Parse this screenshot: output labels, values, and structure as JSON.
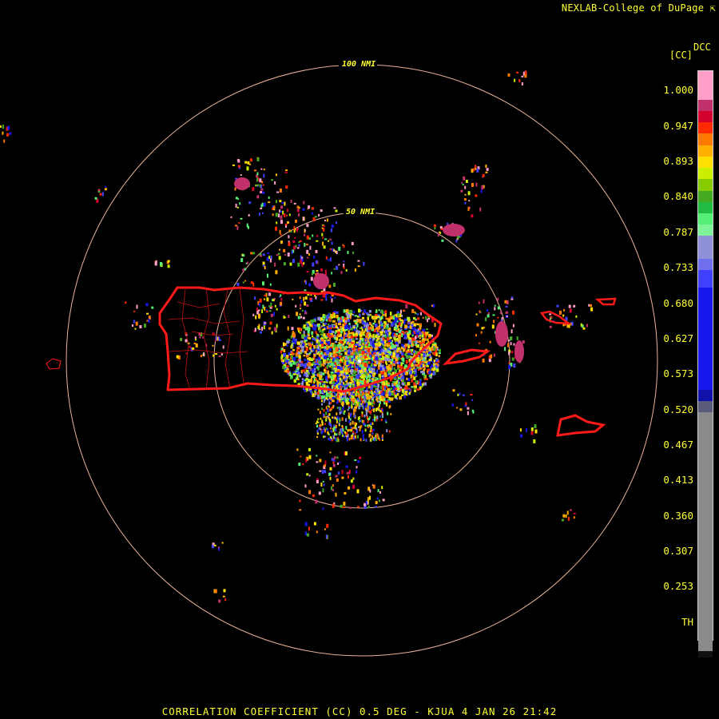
{
  "header": {
    "credit": "NEXLAB-College of DuPage",
    "credit_icon": "corner-arrow-icon"
  },
  "footer": {
    "title": "CORRELATION COEFFICIENT (CC) 0.5 DEG - KJUA 4 JAN 26 21:42"
  },
  "rings": {
    "outer_label": "100 NMI",
    "inner_label": "50 NMI"
  },
  "legend": {
    "product": "DCC",
    "unit": "[CC]",
    "ticks": [
      "1.000",
      "0.947",
      "0.893",
      "0.840",
      "0.787",
      "0.733",
      "0.680",
      "0.627",
      "0.573",
      "0.520",
      "0.467",
      "0.413",
      "0.360",
      "0.307",
      "0.253",
      "TH"
    ],
    "scale": [
      {
        "color": "#ff9fc8",
        "frac": 0.05
      },
      {
        "color": "#c0306a",
        "frac": 0.02
      },
      {
        "color": "#d4002e",
        "frac": 0.02
      },
      {
        "color": "#ff2a00",
        "frac": 0.02
      },
      {
        "color": "#ff7a00",
        "frac": 0.02
      },
      {
        "color": "#ffb000",
        "frac": 0.02
      },
      {
        "color": "#ffe000",
        "frac": 0.02
      },
      {
        "color": "#ccee00",
        "frac": 0.02
      },
      {
        "color": "#88cc00",
        "frac": 0.02
      },
      {
        "color": "#44aa22",
        "frac": 0.02
      },
      {
        "color": "#22bb44",
        "frac": 0.02
      },
      {
        "color": "#55ee77",
        "frac": 0.02
      },
      {
        "color": "#7ff39a",
        "frac": 0.02
      },
      {
        "color": "#9090d8",
        "frac": 0.04
      },
      {
        "color": "#7070ee",
        "frac": 0.02
      },
      {
        "color": "#4040ff",
        "frac": 0.03
      },
      {
        "color": "#1818ee",
        "frac": 0.18
      },
      {
        "color": "#1010aa",
        "frac": 0.02
      },
      {
        "color": "#5a5a7a",
        "frac": 0.02
      },
      {
        "color": "#8a8a8a",
        "frac": 0.42
      },
      {
        "color": "#111111",
        "frac": 0.01
      }
    ]
  },
  "colors": {
    "ring": "#e8b39a",
    "border": "#ff1a1a",
    "municipal": "#c01010",
    "text": "#ffff33"
  }
}
